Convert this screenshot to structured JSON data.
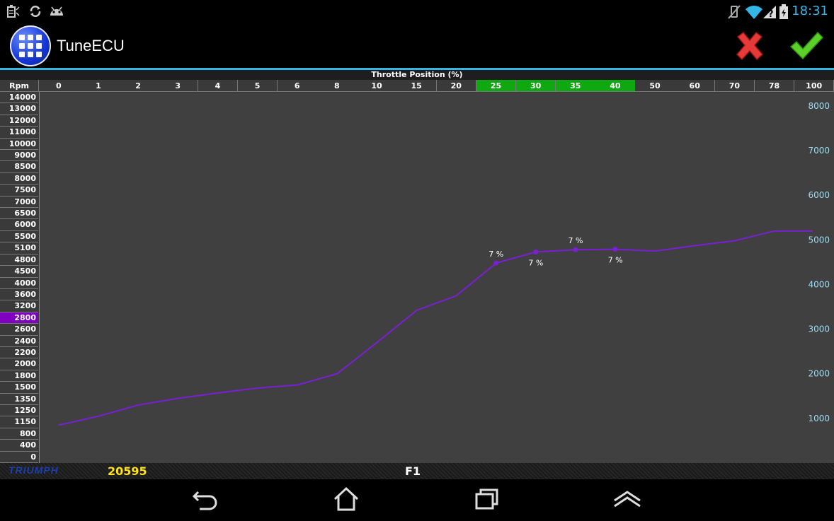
{
  "status_bar": {
    "time": "18:31",
    "left_icons": [
      "battery-saver-icon",
      "sync-icon",
      "android-debug-icon"
    ],
    "right_icons": [
      "no-vibrate-icon",
      "wifi-icon",
      "signal-unknown-icon",
      "battery-icon"
    ]
  },
  "app": {
    "title": "TuneECU",
    "accent_color": "#33b5e5"
  },
  "table": {
    "throttle_title": "Throttle Position (%)",
    "rpm_label": "Rpm",
    "columns": [
      "0",
      "1",
      "2",
      "3",
      "4",
      "5",
      "6",
      "8",
      "10",
      "15",
      "20",
      "25",
      "30",
      "35",
      "40",
      "50",
      "60",
      "70",
      "78",
      "100"
    ],
    "selected_columns": [
      "25",
      "30",
      "35",
      "40"
    ],
    "rows": [
      "14000",
      "13000",
      "12000",
      "11000",
      "10000",
      "9000",
      "8500",
      "8000",
      "7500",
      "7000",
      "6500",
      "6000",
      "5500",
      "5100",
      "4800",
      "4500",
      "4000",
      "3600",
      "3200",
      "2800",
      "2600",
      "2400",
      "2200",
      "2000",
      "1800",
      "1500",
      "1350",
      "1250",
      "1150",
      "800",
      "400",
      "0"
    ],
    "selected_row": "2800",
    "selected_color": "#10a810",
    "row_selected_color": "#8000c0"
  },
  "chart_data": {
    "type": "line",
    "x": [
      "0",
      "1",
      "2",
      "3",
      "4",
      "5",
      "6",
      "8",
      "10",
      "15",
      "20",
      "25",
      "30",
      "35",
      "40",
      "50",
      "60",
      "70",
      "78",
      "100"
    ],
    "series": [
      {
        "values": [
          850,
          1050,
          1300,
          1450,
          1570,
          1680,
          1750,
          2000,
          2700,
          3420,
          3750,
          4480,
          4730,
          4780,
          4790,
          4750,
          4870,
          4980,
          5200,
          5200
        ],
        "color": "#7a1fd6"
      }
    ],
    "yticks": [
      1000,
      2000,
      3000,
      4000,
      5000,
      6000,
      7000,
      8000
    ],
    "ylim": [
      0,
      8300
    ],
    "point_labels": [
      {
        "col": "25",
        "text": "7 %",
        "pos": "above"
      },
      {
        "col": "30",
        "text": "7 %",
        "pos": "below"
      },
      {
        "col": "35",
        "text": "7 %",
        "pos": "above"
      },
      {
        "col": "40",
        "text": "7 %",
        "pos": "below"
      }
    ],
    "tick_color": "#9fdcf0",
    "background": "#404040"
  },
  "footer": {
    "brand": "TRIUMPH",
    "counter": "20595",
    "fkey": "F1",
    "counter_color": "#ffe21a"
  },
  "nav": {
    "back": "back-icon",
    "home": "home-icon",
    "recents": "recents-icon",
    "menu": "menu-up-icon"
  }
}
